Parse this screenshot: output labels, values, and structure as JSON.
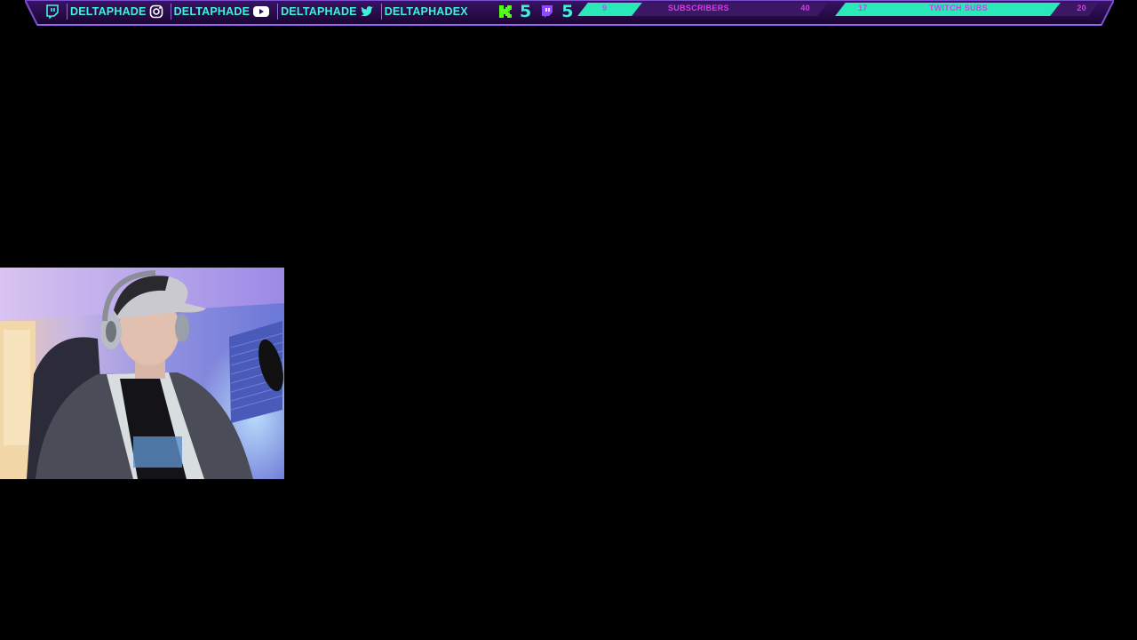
{
  "overlay": {
    "socials": [
      {
        "icon": "twitch-icon",
        "handle": "DELTAPHADE"
      },
      {
        "icon": "instagram-icon",
        "handle": "DELTAPHADE"
      },
      {
        "icon": "youtube-icon",
        "handle": "DELTAPHADE"
      },
      {
        "icon": "twitter-icon",
        "handle": "DELTAPHADEX"
      }
    ],
    "counters": [
      {
        "icon": "kick-icon",
        "value": "5"
      },
      {
        "icon": "twitch-icon",
        "value": "5"
      }
    ],
    "goals": [
      {
        "label": "SUBSCRIBERS",
        "current": "9",
        "target": "40",
        "fraction": 0.225
      },
      {
        "label": "TWITCH SUBS",
        "current": "17",
        "target": "20",
        "fraction": 0.85
      }
    ],
    "colors": {
      "accent": "#3ef2d6",
      "goal_fill": "#2ae8b8",
      "goal_text": "#d63ce8",
      "frame": "#2a0b4a",
      "frame_edge": "#7a4fd0"
    }
  },
  "webcam": {
    "icon": "webcam-feed"
  }
}
